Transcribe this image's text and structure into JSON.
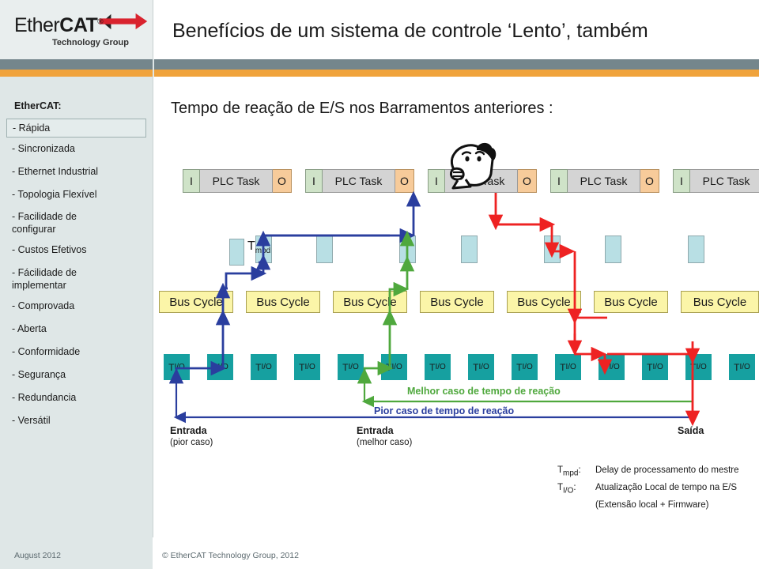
{
  "brand": {
    "logo_main": "Ether",
    "logo_bold": "CAT",
    "logo_reg": "®",
    "logo_sub": "Technology Group",
    "accent_orange": "#f0a33c",
    "accent_grey": "#74868c"
  },
  "header": {
    "title": "Benefícios de um sistema de controle ‘Lento’, também"
  },
  "sidebar": {
    "title": "EtherCAT:",
    "items": [
      {
        "label": "- Rápida",
        "highlighted": true
      },
      {
        "label": "- Sincronizada",
        "highlighted": false
      },
      {
        "label": "- Ethernet Industrial",
        "highlighted": false
      },
      {
        "label": "- Topologia Flexível",
        "highlighted": false
      },
      {
        "label": "- Facilidade de\nconfigurar",
        "highlighted": false
      },
      {
        "label": "- Custos Efetivos",
        "highlighted": false
      },
      {
        "label": "- Fácilidade de\nimplementar",
        "highlighted": false
      },
      {
        "label": "- Comprovada",
        "highlighted": false
      },
      {
        "label": "- Aberta",
        "highlighted": false
      },
      {
        "label": "- Conformidade",
        "highlighted": false
      },
      {
        "label": "- Segurança",
        "highlighted": false
      },
      {
        "label": "- Redundancia",
        "highlighted": false
      },
      {
        "label": "- Versátil",
        "highlighted": false
      }
    ]
  },
  "main": {
    "subtitle": "Tempo de reação de E/S nos Barramentos anteriores :"
  },
  "diagram": {
    "plc_tasks": [
      {
        "in": "I",
        "label": "PLC Task",
        "out": "O"
      },
      {
        "in": "I",
        "label": "PLC Task",
        "out": "O"
      },
      {
        "in": "I",
        "label": "PLC Task",
        "out": "O"
      },
      {
        "in": "I",
        "label": "PLC Task",
        "out": "O"
      },
      {
        "in": "I",
        "label": "PLC Task",
        "out": ""
      }
    ],
    "bus_cycle_label": "Bus Cycle",
    "bus_cycle_count": 7,
    "tio_label_t": "T",
    "tio_label_sub": "I/O",
    "tio_count": 15,
    "tmpd_legend": {
      "t": "T",
      "sub": "mpd"
    },
    "labels": {
      "best_case_reaction": "Melhor caso de tempo de reação",
      "worst_case_reaction": "Pior caso de tempo de reação",
      "entrada_worst_title": "Entrada",
      "entrada_worst_sub": "(pior caso)",
      "entrada_best_title": "Entrada",
      "entrada_best_sub": "(melhor caso)",
      "saida": "Saída"
    },
    "colors": {
      "worst_case": "#2a3e9e",
      "best_case": "#4fa83d",
      "output_path": "#ee2222",
      "bus_cycle_fill": "#fbf5a8",
      "tio_fill": "#16a0a0",
      "tmpd_fill": "#b8dfe4",
      "plc_in_fill": "#cfe3c8",
      "plc_out_fill": "#f7cb9a",
      "plc_body_fill": "#d4d4d4"
    }
  },
  "legend": [
    {
      "key_t": "T",
      "key_sub": "mpd",
      "key_sep": ":",
      "text": "Delay de processamento do mestre"
    },
    {
      "key_t": "T",
      "key_sub": "I/O",
      "key_sep": ":",
      "text": "Atualização Local de tempo na E/S"
    },
    {
      "key_t": "",
      "key_sub": "",
      "key_sep": "",
      "text": "(Extensão local + Firmware)"
    }
  ],
  "footer": {
    "date": "August 2012",
    "copyright": "© EtherCAT Technology Group, 2012"
  }
}
